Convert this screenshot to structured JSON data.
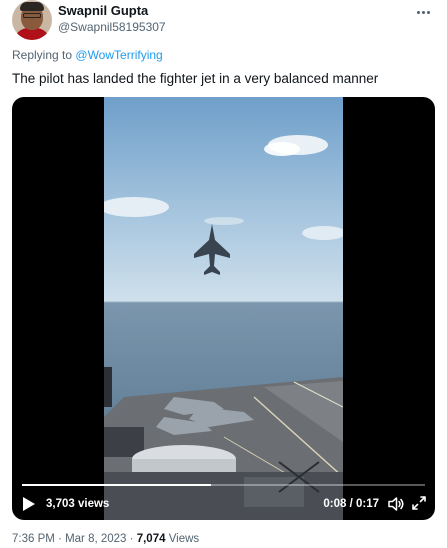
{
  "author": {
    "display_name": "Swapnil Gupta",
    "handle": "@Swapnil58195307"
  },
  "reply": {
    "prefix": "Replying to",
    "target": "@WowTerrifying"
  },
  "tweet": {
    "text": "The pilot has landed the fighter jet in a very balanced manner"
  },
  "video": {
    "views": "3,703 views",
    "time": "0:08 / 0:17",
    "progress": 0.47
  },
  "meta": {
    "time": "7:36 PM",
    "date": "Mar 8, 2023",
    "separator": "·",
    "view_count": "7,074",
    "view_label": "Views"
  }
}
